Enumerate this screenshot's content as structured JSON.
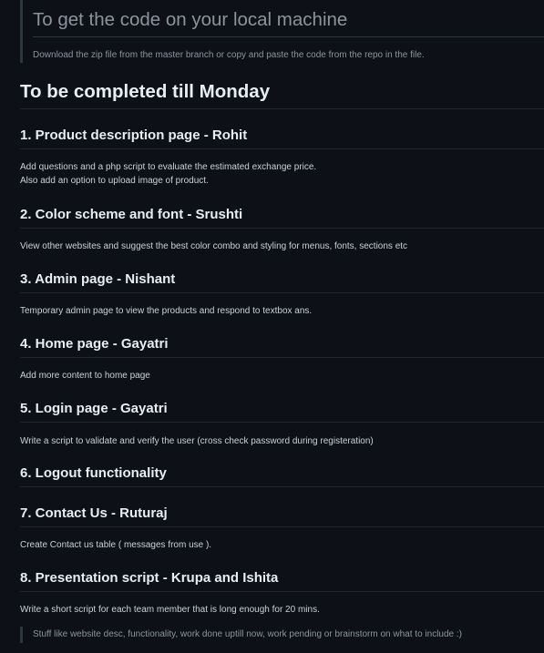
{
  "top_quote": {
    "heading": "To get the code on your local machine",
    "text": "Download the zip file from the master branch or copy and paste the code from the repo in the file."
  },
  "main_heading": "To be completed till Monday",
  "tasks": [
    {
      "title": "1. Product description page - Rohit",
      "lines": [
        "Add questions and a php script to evaluate the estimated exchange price.",
        "Also add an option to upload image of product."
      ]
    },
    {
      "title": "2. Color scheme and font - Srushti",
      "lines": [
        "View other websites and suggest the best color combo and styling for menus, fonts, sections etc"
      ]
    },
    {
      "title": "3. Admin page - Nishant",
      "lines": [
        "Temporary admin page to view the products and respond to textbox ans."
      ]
    },
    {
      "title": "4. Home page - Gayatri",
      "lines": [
        "Add more content to home page"
      ]
    },
    {
      "title": "5. Login page - Gayatri",
      "lines": [
        "Write a script to validate and verify the user (cross check password during registeration)"
      ]
    },
    {
      "title": "6. Logout functionality",
      "lines": []
    },
    {
      "title": "7. Contact Us - Ruturaj",
      "lines": [
        "Create Contact us table ( messages from use )."
      ]
    },
    {
      "title": "8. Presentation script - Krupa and Ishita",
      "lines": [
        "Write a short script for each team member that is long enough for 20 mins."
      ]
    }
  ],
  "bottom_quote": "Stuff like website desc, functionality, work done uptill now, work pending or brainstorm on what to include :)"
}
